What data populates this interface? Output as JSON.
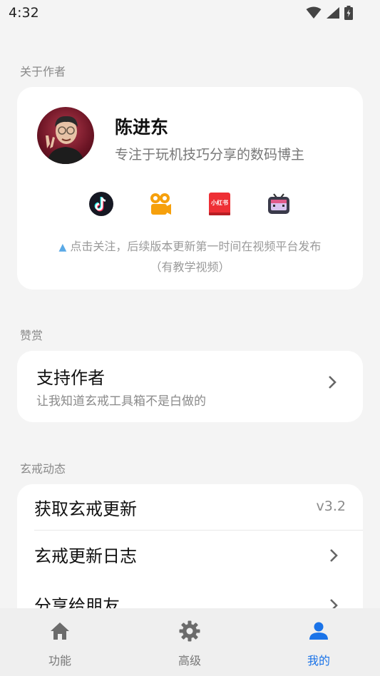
{
  "status_bar": {
    "time": "4:32"
  },
  "sections": {
    "about_author": "关于作者",
    "donate": "赞赏",
    "xuanjie_news": "玄戒动态"
  },
  "author": {
    "name": "陈进东",
    "description": "专注于玩机技巧分享的数码博主",
    "social_icons": [
      "douyin-icon",
      "kuaishou-icon",
      "xiaohongshu-icon",
      "bilibili-icon"
    ],
    "xiaohongshu_text": "小红书",
    "hint_line1": "点击关注，后续版本更新第一时间在视频平台发布",
    "hint_line2": "（有教学视频）"
  },
  "support": {
    "title": "支持作者",
    "subtitle": "让我知道玄戒工具箱不是白做的"
  },
  "dynamics": {
    "items": [
      {
        "label": "获取玄戒更新",
        "value": "v3.2"
      },
      {
        "label": "玄戒更新日志"
      },
      {
        "label": "分享给朋友"
      }
    ]
  },
  "bottom_nav": {
    "items": [
      {
        "label": "功能",
        "icon": "home-icon"
      },
      {
        "label": "高级",
        "icon": "gear-icon"
      },
      {
        "label": "我的",
        "icon": "person-icon",
        "active": true
      }
    ]
  },
  "colors": {
    "accent": "#1a73e8",
    "background": "#f4f4f4",
    "card": "#ffffff"
  }
}
